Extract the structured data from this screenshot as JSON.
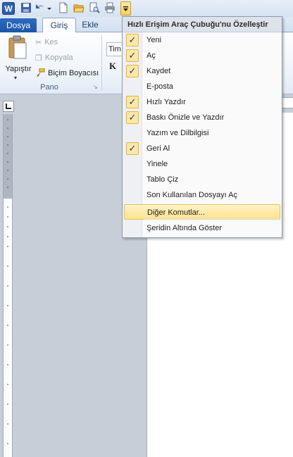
{
  "tabs": {
    "file": "Dosya",
    "home": "Giriş",
    "insert": "Ekle"
  },
  "clipboard": {
    "paste": "Yapıştır",
    "cut": "Kes",
    "copy": "Kopyala",
    "format_painter": "Biçim Boyacısı",
    "group": "Pano"
  },
  "font": {
    "name_prefix": "Tim",
    "bold_glyph": "K"
  },
  "menu": {
    "title": "Hızlı Erişim Araç Çubuğu'nu Özelleştir",
    "items": [
      {
        "label": "Yeni",
        "checked": true
      },
      {
        "label": "Aç",
        "checked": true
      },
      {
        "label": "Kaydet",
        "checked": true
      },
      {
        "label": "E-posta",
        "checked": false
      },
      {
        "label": "Hızlı Yazdır",
        "checked": true
      },
      {
        "label": "Baskı Önizle ve Yazdır",
        "checked": true
      },
      {
        "label": "Yazım ve Dilbilgisi",
        "checked": false
      },
      {
        "label": "Geri Al",
        "checked": true
      },
      {
        "label": "Yinele",
        "checked": false
      },
      {
        "label": "Tablo Çiz",
        "checked": false
      },
      {
        "label": "Son Kullanılan Dosyayı Aç",
        "checked": false
      }
    ],
    "more_commands": "Diğer Komutlar...",
    "show_below": "Şeridin Altında Göster"
  },
  "colors": {
    "accent": "#1a56a8",
    "highlight": "#fde38d"
  }
}
